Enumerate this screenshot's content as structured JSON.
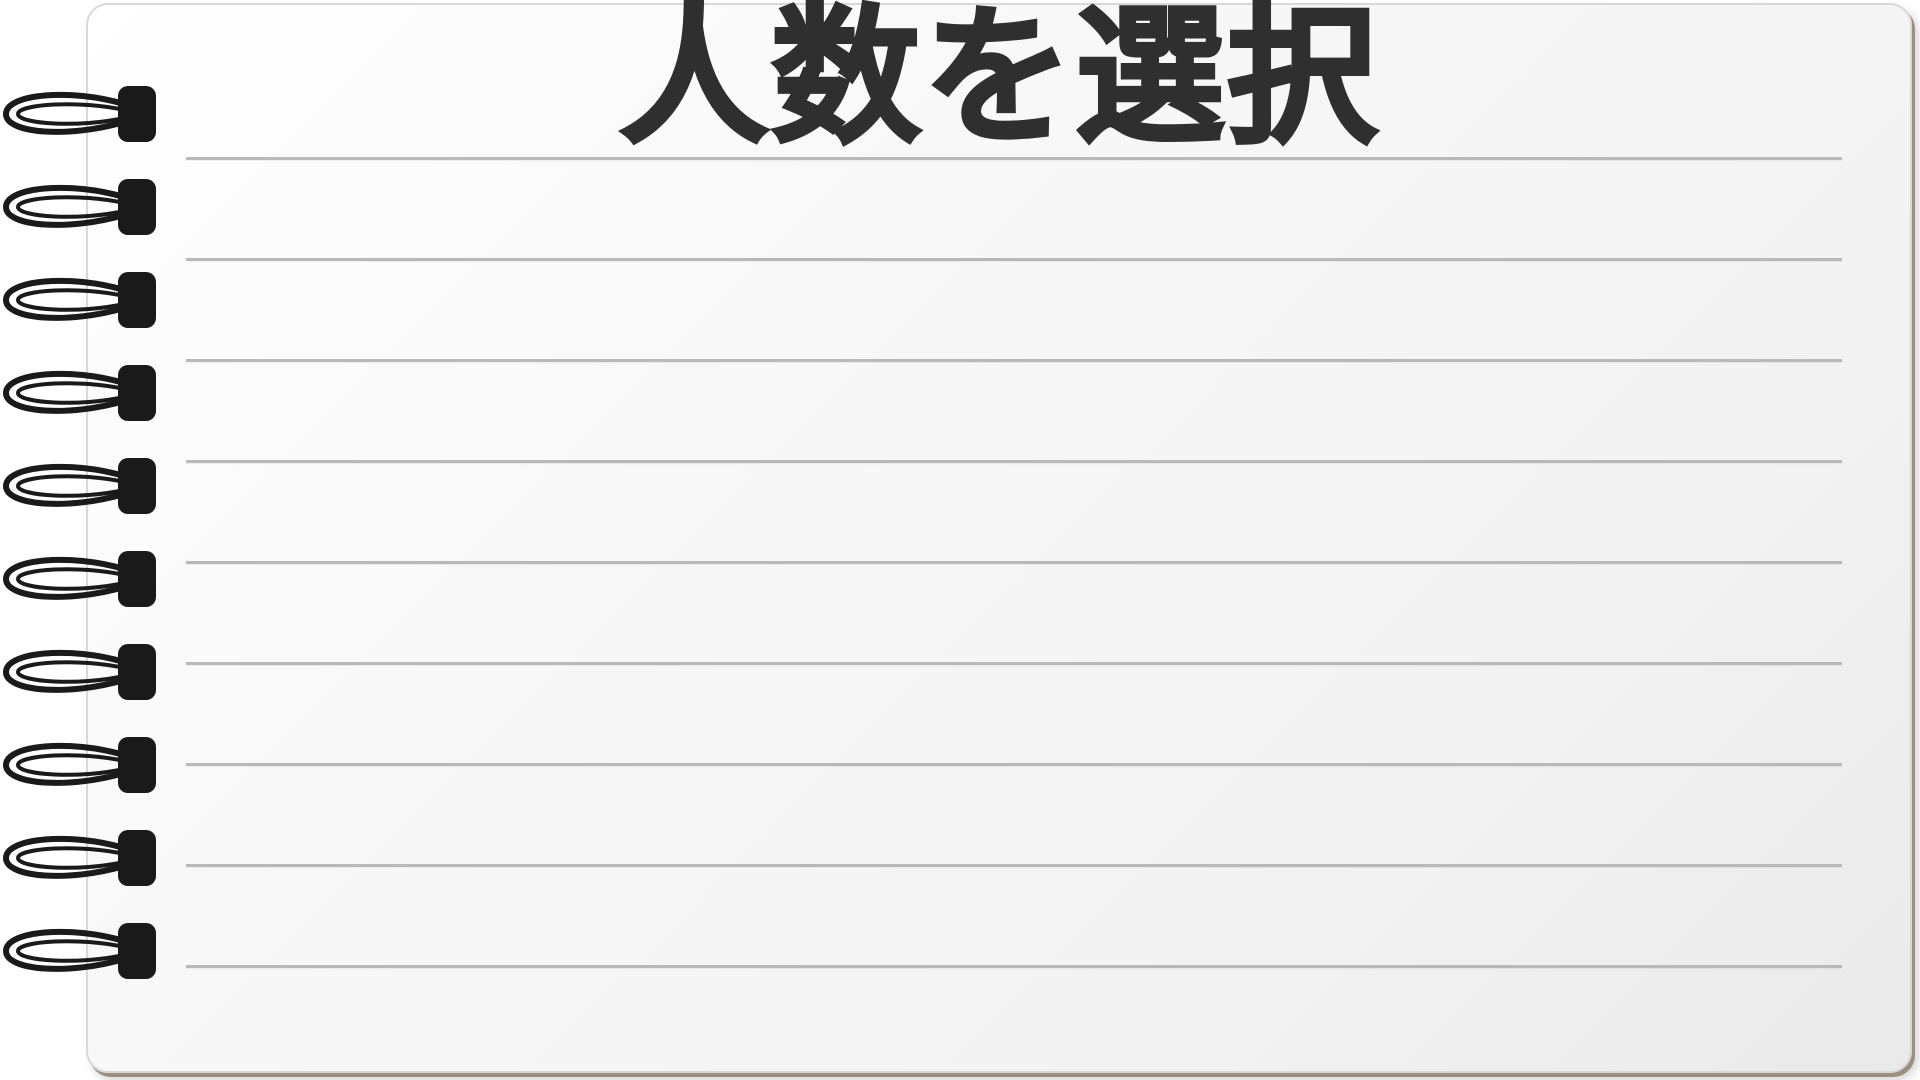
{
  "page": {
    "title": "人数を選択"
  },
  "notebook": {
    "paper_color": "#f4f4f4",
    "line_color": "#b9b9b9",
    "ring_color": "#1a1a1a",
    "rule_count": 9,
    "ring_count": 10
  }
}
